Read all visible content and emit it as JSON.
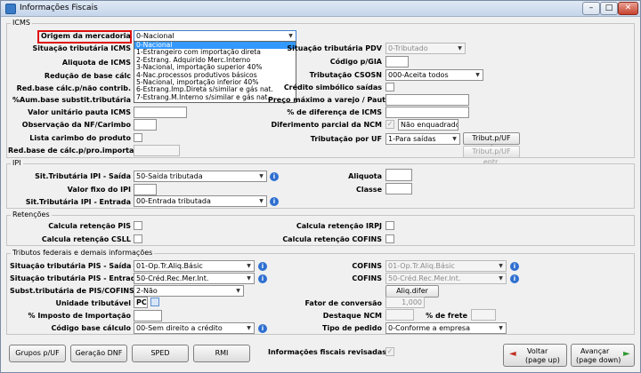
{
  "window": {
    "title": "Informações Fiscais"
  },
  "icms": {
    "title": "ICMS",
    "origem": {
      "label": "Origem da mercadoria",
      "value": "0-Nacional",
      "options": [
        "0-Nacional",
        "1-Estrangeiro com importação direta",
        "2-Estrang. Adquirido Merc.Interno",
        "3-Nacional, importação superior 40%",
        "4-Nac.processos produtivos básicos",
        "5-Nacional, importação inferior 40%",
        "6-Estrang.Imp.Direta s/similar e gás nat.",
        "7-Estrang.M.Interno s/similar e gás nat."
      ]
    },
    "left_labels": [
      "Situação tributária ICMS",
      "Aliquota de ICMS",
      "Redução de base cálc",
      "Red.base cálc.p/não contrib.",
      "%Aum.base substit.tributária",
      "Valor unitário pauta ICMS",
      "Observação da NF/Carimbo",
      "Lista carimbo do produto",
      "Red.base de cálc.p/pro.importado"
    ],
    "sit_pdv": {
      "label": "Situação tributária PDV",
      "value": "0-Tributado"
    },
    "codigo_gia": {
      "label": "Código p/GIA"
    },
    "trib_csosn": {
      "label": "Tributação CSOSN",
      "value": "000-Aceita todos"
    },
    "credito_simb": {
      "label": "Crédito simbólico saídas"
    },
    "preco_pauta": {
      "label": "Preço máximo a varejo / Pauta ST"
    },
    "perc_dif": {
      "label": "% de diferença de ICMS"
    },
    "diferimento": {
      "label": "Diferimento parcial da NCM",
      "value": "Não enquadrado"
    },
    "trib_uf": {
      "label": "Tributação por UF",
      "value": "1-Para saídas",
      "btn_saida": "Tribut.p/UF saída",
      "btn_entrada": "Tribut.p/UF entr."
    }
  },
  "ipi": {
    "title": "IPI",
    "sit_saida": {
      "label": "Sit.Tributária IPI - Saída",
      "value": "50-Saída tributada"
    },
    "valor_fixo": {
      "label": "Valor fixo do IPI"
    },
    "sit_entrada": {
      "label": "Sit.Tributária IPI - Entrada",
      "value": "00-Entrada tributada"
    },
    "aliquota": {
      "label": "Aliquota"
    },
    "classe": {
      "label": "Classe"
    }
  },
  "retencoes": {
    "title": "Retenções",
    "pis": "Calcula retenção PIS",
    "csll": "Calcula retenção CSLL",
    "irpj": "Calcula retenção IRPJ",
    "cofins": "Calcula retenção COFINS"
  },
  "tributos": {
    "title": "Tributos federais e demais informações",
    "pis_saida": {
      "label": "Situação tributária PIS - Saída",
      "value": "01-Op.Tr.Aliq.Básic"
    },
    "pis_entrada": {
      "label": "Situação tributária PIS - Entrada",
      "value": "50-Créd.Rec.Mer.Int."
    },
    "subst": {
      "label": "Subst.tributária de PIS/COFINS",
      "value": "2-Não"
    },
    "unidade": {
      "label": "Unidade tributável",
      "value": "PC"
    },
    "imposto_imp": {
      "label": "% Imposto de Importação"
    },
    "cod_base": {
      "label": "Código base cálculo",
      "value": "00-Sem direito a crédito"
    },
    "cofins1": {
      "label": "COFINS",
      "value": "01-Op.Tr.Aliq.Básic"
    },
    "cofins2": {
      "label": "COFINS",
      "value": "50-Créd.Rec.Mer.Int."
    },
    "aliq_btn": "Aliq.difer",
    "fator": {
      "label": "Fator de conversão",
      "value": "1,000"
    },
    "destaque": {
      "label": "Destaque NCM"
    },
    "frete": {
      "label": "% de frete"
    },
    "tipo_pedido": {
      "label": "Tipo de pedido",
      "value": "0-Conforme a empresa"
    }
  },
  "footer": {
    "buttons": [
      "Grupos p/UF",
      "Geração DNF",
      "SPED",
      "RMI"
    ],
    "revisadas": "Informações fiscais revisadas",
    "voltar": "Voltar",
    "voltar_sub": "(page up)",
    "avancar": "Avançar",
    "avancar_sub": "(page down)"
  }
}
